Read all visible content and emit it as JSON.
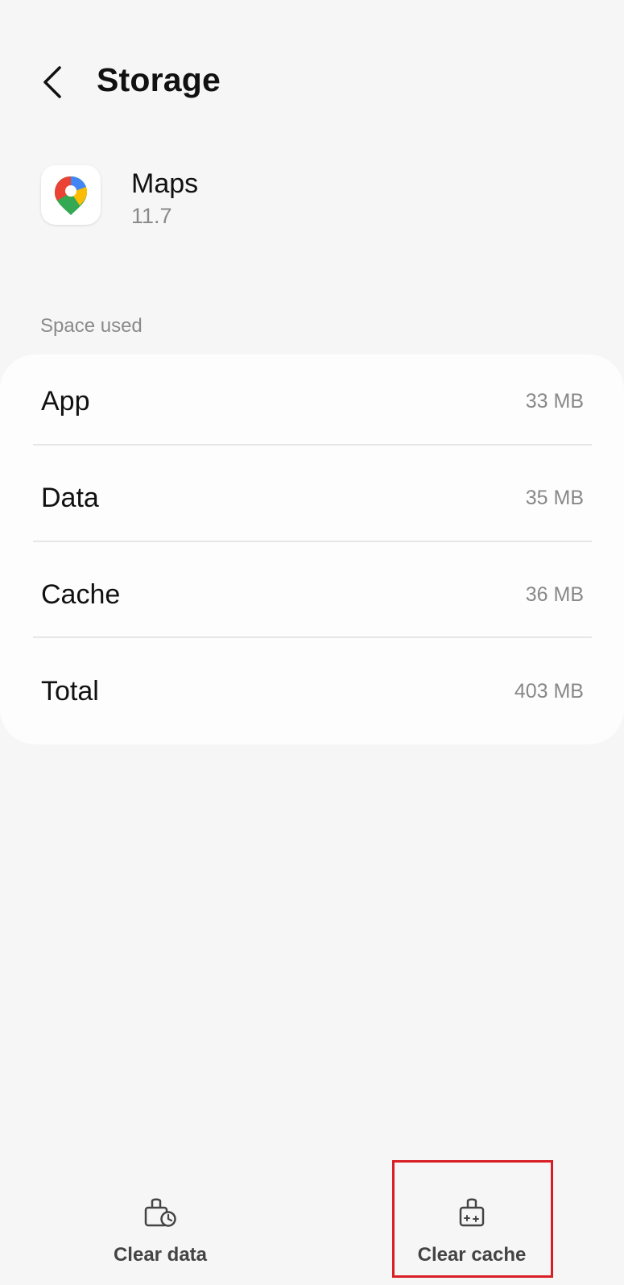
{
  "header": {
    "title": "Storage"
  },
  "app": {
    "name": "Maps",
    "version": "11.7",
    "icon": "google-maps-pin"
  },
  "section": {
    "label": "Space used"
  },
  "storage": {
    "rows": [
      {
        "label": "App",
        "value": "33 MB"
      },
      {
        "label": "Data",
        "value": "35 MB"
      },
      {
        "label": "Cache",
        "value": "36 MB"
      },
      {
        "label": "Total",
        "value": "403 MB"
      }
    ]
  },
  "actions": {
    "clear_data": {
      "label": "Clear data",
      "icon": "clear-data-icon"
    },
    "clear_cache": {
      "label": "Clear cache",
      "icon": "clear-cache-icon"
    }
  },
  "colors": {
    "background": "#f6f6f6",
    "card": "#fdfdfd",
    "highlight": "#d81f26",
    "secondary_text": "#888888"
  }
}
